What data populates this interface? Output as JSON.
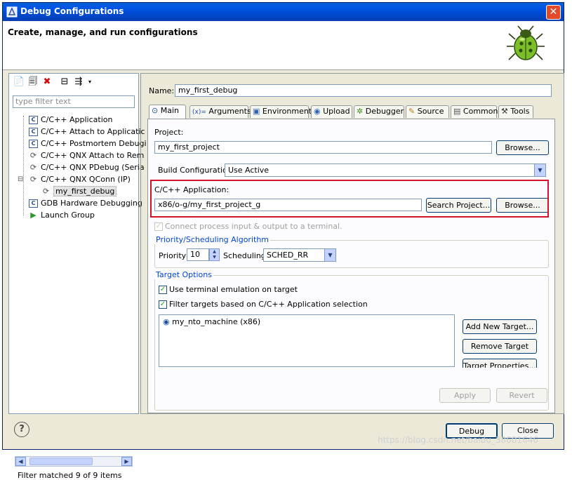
{
  "window": {
    "title": "Debug Configurations",
    "header": "Create, manage, and run configurations"
  },
  "left": {
    "filter_placeholder": "type filter text",
    "tree": [
      {
        "label": "C/C++ Application",
        "icon": "c-config-icon",
        "level": 1
      },
      {
        "label": "C/C++ Attach to Applicatic",
        "icon": "c-config-icon",
        "level": 1
      },
      {
        "label": "C/C++ Postmortem Debugi",
        "icon": "c-config-icon",
        "level": 1
      },
      {
        "label": "C/C++ QNX Attach to Rem",
        "icon": "qnx-config-icon",
        "level": 1
      },
      {
        "label": "C/C++ QNX PDebug (Seria",
        "icon": "qnx-config-icon",
        "level": 1
      },
      {
        "label": "C/C++ QNX QConn (IP)",
        "icon": "qnx-config-icon",
        "level": 1,
        "expanded": true
      },
      {
        "label": "my_first_debug",
        "icon": "qnx-config-icon",
        "level": 2,
        "selected": true
      },
      {
        "label": "GDB Hardware Debugging",
        "icon": "c-config-icon",
        "level": 1
      },
      {
        "label": "Launch Group",
        "icon": "launch-group-icon",
        "level": 1
      }
    ],
    "filter_status": "Filter matched 9 of 9 items"
  },
  "right": {
    "name_label": "Name:",
    "name_value": "my_first_debug",
    "tabs": [
      {
        "label": "Main",
        "icon": "main-tab-icon",
        "active": true
      },
      {
        "label": "Arguments",
        "icon": "arguments-tab-icon"
      },
      {
        "label": "Environment",
        "icon": "environment-tab-icon"
      },
      {
        "label": "Upload",
        "icon": "upload-tab-icon"
      },
      {
        "label": "Debugger",
        "icon": "debugger-tab-icon"
      },
      {
        "label": "Source",
        "icon": "source-tab-icon"
      },
      {
        "label": "Common",
        "icon": "common-tab-icon"
      },
      {
        "label": "Tools",
        "icon": "tools-tab-icon"
      }
    ],
    "project_label": "Project:",
    "project_value": "my_first_project",
    "browse_label": "Browse...",
    "build_config_label": "Build Configuration",
    "build_config_value": "Use Active",
    "app_label": "C/C++ Application:",
    "app_value": "x86/o-g/my_first_project_g",
    "search_project_label": "Search Project...",
    "connect_label": "Connect process input & output to a terminal.",
    "priority_group": "Priority/Scheduling Algorithm",
    "priority_label": "Priority",
    "priority_value": "10",
    "scheduling_label": "Scheduling",
    "scheduling_value": "SCHED_RR",
    "target_group": "Target Options",
    "use_terminal_label": "Use terminal emulation on target",
    "filter_targets_label": "Filter targets based on C/C++ Application selection",
    "target_item": "my_nto_machine (x86)",
    "add_target_label": "Add New Target...",
    "remove_target_label": "Remove Target",
    "target_props_label": "Target Properties...",
    "apply_label": "Apply",
    "revert_label": "Revert"
  },
  "footer": {
    "debug_label": "Debug",
    "close_label": "Close",
    "help_icon": "help-icon"
  },
  "watermark": "https://blog.csdn.net/baidu_38601646"
}
